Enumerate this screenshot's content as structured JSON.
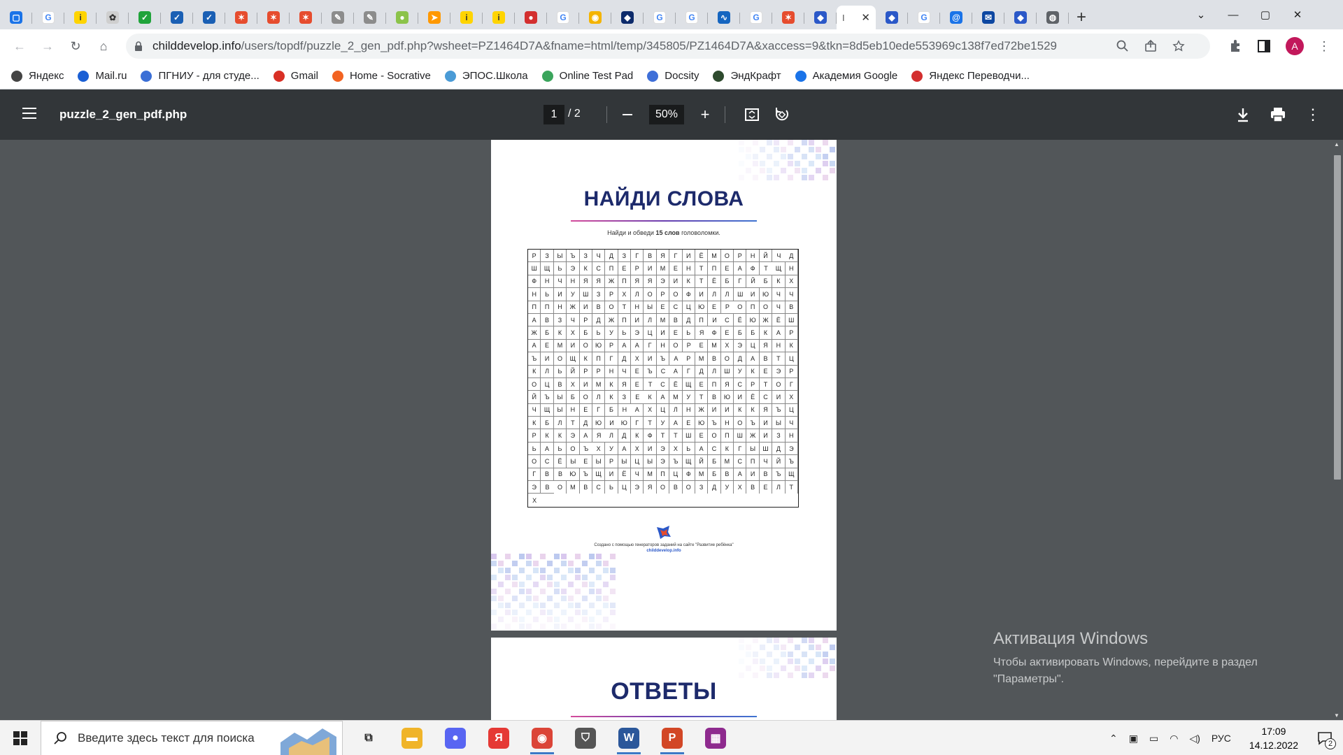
{
  "browser": {
    "tabs": [
      {
        "icon": "chat-icon",
        "color": "#1a73e8",
        "glyph": "▢"
      },
      {
        "icon": "google-icon",
        "color": "#ffffff",
        "glyph": "G"
      },
      {
        "icon": "yandex-icon",
        "color": "#ffd400",
        "glyph": "i"
      },
      {
        "icon": "puzzle-icon",
        "color": "#cfcfcf",
        "glyph": "✿"
      },
      {
        "icon": "check-icon",
        "color": "#1fa33a",
        "glyph": "✓"
      },
      {
        "icon": "check-icon",
        "color": "#1a5fb4",
        "glyph": "✓"
      },
      {
        "icon": "check-icon",
        "color": "#1a5fb4",
        "glyph": "✓"
      },
      {
        "icon": "star-icon",
        "color": "#e64c2e",
        "glyph": "✶"
      },
      {
        "icon": "star-icon",
        "color": "#e64c2e",
        "glyph": "✶"
      },
      {
        "icon": "star-icon",
        "color": "#e64c2e",
        "glyph": "✶"
      },
      {
        "icon": "notepad-icon",
        "color": "#8c8c8c",
        "glyph": "✎"
      },
      {
        "icon": "notepad-icon",
        "color": "#8c8c8c",
        "glyph": "✎"
      },
      {
        "icon": "apple-icon",
        "color": "#8bc34a",
        "glyph": "●"
      },
      {
        "icon": "paper-plane-icon",
        "color": "#ff9800",
        "glyph": "➤"
      },
      {
        "icon": "yandex-icon",
        "color": "#ffd400",
        "glyph": "i"
      },
      {
        "icon": "yandex-icon",
        "color": "#ffd400",
        "glyph": "i"
      },
      {
        "icon": "ladybug-icon",
        "color": "#d32f2f",
        "glyph": "●"
      },
      {
        "icon": "google-icon",
        "color": "#ffffff",
        "glyph": "G"
      },
      {
        "icon": "chrome-icon",
        "color": "#f4b400",
        "glyph": "◉"
      },
      {
        "icon": "shield-icon",
        "color": "#0d2b6b",
        "glyph": "◆"
      },
      {
        "icon": "google-icon",
        "color": "#ffffff",
        "glyph": "G"
      },
      {
        "icon": "google-icon",
        "color": "#ffffff",
        "glyph": "G"
      },
      {
        "icon": "chart-icon",
        "color": "#1565c0",
        "glyph": "∿"
      },
      {
        "icon": "google-icon",
        "color": "#ffffff",
        "glyph": "G"
      },
      {
        "icon": "star-icon",
        "color": "#e64c2e",
        "glyph": "✶"
      },
      {
        "icon": "childdevelop-icon",
        "color": "#2b58c8",
        "glyph": "◆"
      }
    ],
    "tabs_after": [
      {
        "icon": "childdevelop-icon",
        "color": "#2b58c8",
        "glyph": "◆"
      },
      {
        "icon": "google-icon",
        "color": "#ffffff",
        "glyph": "G"
      },
      {
        "icon": "mail-icon",
        "color": "#1a73e8",
        "glyph": "@"
      },
      {
        "icon": "mail-icon",
        "color": "#0d47a1",
        "glyph": "✉"
      },
      {
        "icon": "childdevelop-icon",
        "color": "#2b58c8",
        "glyph": "◆"
      },
      {
        "icon": "globe-icon",
        "color": "#5f6368",
        "glyph": "◍"
      }
    ],
    "active_tab": {
      "label": "I",
      "close": "✕"
    },
    "new_tab": "+",
    "window": {
      "tab_search": "⌄",
      "minimize": "—",
      "maximize": "▢",
      "close": "✕"
    },
    "nav": {
      "back": "←",
      "forward": "→",
      "reload": "↻",
      "home": "⌂"
    },
    "url": {
      "host": "childdevelop.info",
      "path": "/users/topdf/puzzle_2_gen_pdf.php?wsheet=PZ1464D7A&fname=html/temp/345805/PZ1464D7A&xaccess=9&tkn=8d5eb10ede553969c138f7ed72be1529"
    },
    "profile_initial": "A",
    "bookmarks": [
      {
        "label": "Яндекс",
        "color": "#444"
      },
      {
        "label": "Mail.ru",
        "color": "#1a5fd4"
      },
      {
        "label": "ПГНИУ - для студе...",
        "color": "#3b6fd6"
      },
      {
        "label": "Gmail",
        "color": "#d93025"
      },
      {
        "label": "Home - Socrative",
        "color": "#f26322"
      },
      {
        "label": "ЭПОС.Школа",
        "color": "#4a9bd6"
      },
      {
        "label": "Online Test Pad",
        "color": "#3ba55c"
      },
      {
        "label": "Docsity",
        "color": "#3e6fd8"
      },
      {
        "label": "ЭндКрафт",
        "color": "#2e4a2e"
      },
      {
        "label": "Академия Google",
        "color": "#1a73e8"
      },
      {
        "label": "Яндекс Переводчи...",
        "color": "#d32f2f"
      }
    ]
  },
  "pdf": {
    "title": "puzzle_2_gen_pdf.php",
    "page_current": "1",
    "page_total": "/  2",
    "zoom": "50%",
    "page1": {
      "heading": "НАЙДИ СЛОВА",
      "instruction_pre": "Найди и обведи ",
      "instruction_bold": "15 слов",
      "instruction_post": " головоломки.",
      "grid_rows": [
        "РЗЫЪЗЧДЗГВЯГИЁМОРНЙЧ",
        "ДШЩЬЭКСПЕРИМЕНТПЕАФТ",
        "ЩНФНЧНЯЯЖПЯЯЭИКТЁБГЙ",
        "БКХНЬИУШЗРХЛОРОФИЛЛШ",
        "ИЮЧЧППНЖИВОТНЫЕСЦЮЕР",
        "ОПОЧВАВЗЧРДЖПИЛМВДПИ",
        "СЁЮЖЁШЖБКХБЬУЬЭЦИЕЬЯ",
        "ФЕББКАРАЕМИОЮРААГНОР",
        "ЕМХЭЦЯНКЪИОЩКПГДХИЪА",
        "РМВОДАВТЦКЛЬЙРРНЧЕЪС",
        "АГДЛШУКЕЭРОЦВХИМКЯЕТ",
        "СЁЩЕПЯСРТОГЙЪЫБОЛКЗЕ",
        "КАМУТВЮИЁСИХЧЩЫНЕГБН",
        "АХЦЛНЖИИККЯЪЦКБЛТДЮИ",
        "ЮГТУАЕЮЪНОЪИЫЧРККЭАЯ",
        "ЛДКФТТШЕОПШЖИЗНЬАЬОЪ",
        "ХУАХИЭХЬАСКГЫШДЭОСЁЫ",
        "ЕЫРЫЦЫЭЪЩЙБМСПЧЙЪГВВ",
        "ЮЪЩИЁЧМПЦФМБВАИВЪЩЭВ",
        "ОМВСЬЦЭЯОВОЗДУХВЕЛТХ"
      ],
      "credit_line": "Создано с помощью генераторов заданий на сайте \"Развитие ребёнка\"",
      "credit_site": "childdevelop.info"
    },
    "page2": {
      "heading": "ОТВЕТЫ"
    }
  },
  "watermark": {
    "title": "Активация Windows",
    "line1": "Чтобы активировать Windows, перейдите в раздел",
    "line2": "\"Параметры\"."
  },
  "taskbar": {
    "search_placeholder": "Введите здесь текст для поиска",
    "apps": [
      {
        "icon": "task-view-icon",
        "color": "#333",
        "glyph": "⧉"
      },
      {
        "icon": "file-explorer-icon",
        "color": "#f0b429",
        "glyph": "▬"
      },
      {
        "icon": "discord-icon",
        "color": "#5865f2",
        "glyph": "●"
      },
      {
        "icon": "yandex-browser-icon",
        "color": "#e53935",
        "glyph": "Я"
      },
      {
        "icon": "chrome-icon",
        "color": "#db4437",
        "glyph": "◉"
      },
      {
        "icon": "world-of-tanks-icon",
        "color": "#555",
        "glyph": "⛉"
      },
      {
        "icon": "word-icon",
        "color": "#2b579a",
        "glyph": "W"
      },
      {
        "icon": "powerpoint-icon",
        "color": "#d24726",
        "glyph": "P"
      },
      {
        "icon": "winrar-icon",
        "color": "#8e2a8e",
        "glyph": "▦"
      }
    ],
    "active_apps": [
      4,
      6,
      7
    ],
    "language": "РУС",
    "time": "17:09",
    "date": "14.12.2022",
    "notifications": "2"
  }
}
